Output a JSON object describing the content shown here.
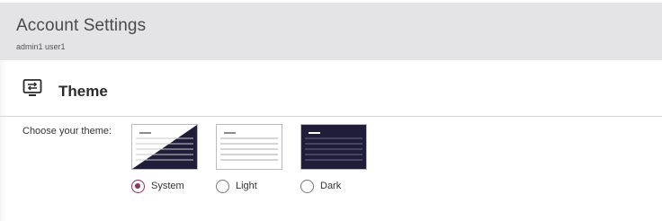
{
  "header": {
    "title": "Account Settings",
    "subtitle": "admin1 user1"
  },
  "section": {
    "icon": "monitor-swap-icon",
    "title": "Theme"
  },
  "theme_picker": {
    "label": "Choose your theme:",
    "selected": "System",
    "options": [
      {
        "label": "System",
        "checked": true
      },
      {
        "label": "Light",
        "checked": false
      },
      {
        "label": "Dark",
        "checked": false
      }
    ]
  },
  "colors": {
    "header_bg": "#e4e4e6",
    "accent": "#8a3558",
    "dark_theme": "#1f1d3a"
  }
}
